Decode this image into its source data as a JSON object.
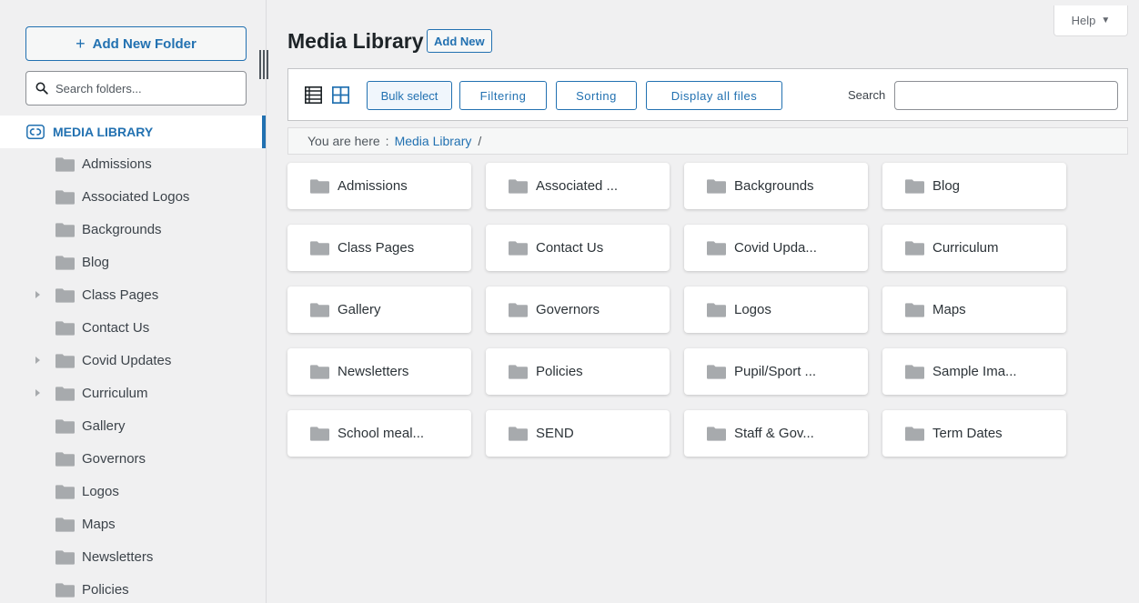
{
  "sidebar": {
    "add_folder_label": "Add New Folder",
    "add_folder_plus": "+",
    "search_placeholder": "Search folders...",
    "root_label": "MEDIA LIBRARY",
    "items": [
      {
        "label": "Admissions",
        "expandable": false
      },
      {
        "label": "Associated Logos",
        "expandable": false
      },
      {
        "label": "Backgrounds",
        "expandable": false
      },
      {
        "label": "Blog",
        "expandable": false
      },
      {
        "label": "Class Pages",
        "expandable": true
      },
      {
        "label": "Contact Us",
        "expandable": false
      },
      {
        "label": "Covid Updates",
        "expandable": true
      },
      {
        "label": "Curriculum",
        "expandable": true
      },
      {
        "label": "Gallery",
        "expandable": false
      },
      {
        "label": "Governors",
        "expandable": false
      },
      {
        "label": "Logos",
        "expandable": false
      },
      {
        "label": "Maps",
        "expandable": false
      },
      {
        "label": "Newsletters",
        "expandable": false
      },
      {
        "label": "Policies",
        "expandable": false
      }
    ]
  },
  "header": {
    "title": "Media Library",
    "add_new_label": "Add New",
    "help_label": "Help",
    "help_arrow": "▼"
  },
  "toolbar": {
    "bulk_select_label": "Bulk select",
    "filtering_label": "Filtering",
    "sorting_label": "Sorting",
    "display_all_label": "Display all files",
    "search_label": "Search",
    "search_value": ""
  },
  "breadcrumb": {
    "prefix": "You are here",
    "separator": ":",
    "current": "Media Library",
    "trailing": "/"
  },
  "grid": {
    "folders": [
      "Admissions",
      "Associated ...",
      "Backgrounds",
      "Blog",
      "Class Pages",
      "Contact Us",
      "Covid Upda...",
      "Curriculum",
      "Gallery",
      "Governors",
      "Logos",
      "Maps",
      "Newsletters",
      "Policies",
      "Pupil/Sport ...",
      "Sample Ima...",
      "School meal...",
      "SEND",
      "Staff & Gov...",
      "Term Dates"
    ]
  },
  "colors": {
    "accent": "#2271b1",
    "folder_icon": "#a7aaad",
    "background": "#f0f0f1"
  },
  "icons": {
    "search": "search-icon",
    "root": "media-library-logo-icon",
    "folder": "folder-icon",
    "list_view": "list-view-icon",
    "grid_view": "grid-view-icon"
  }
}
